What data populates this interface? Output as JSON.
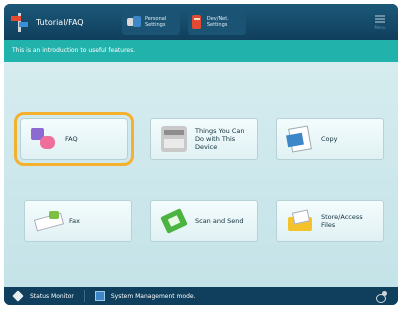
{
  "header": {
    "title": "Tutorial/FAQ",
    "personal_settings": "Personal Settings",
    "device_settings": "Dev/Net. Settings",
    "menu_label": "Menu"
  },
  "intro_text": "This is an introduction to useful features.",
  "tiles": [
    {
      "label": "FAQ",
      "icon": "faq-icon"
    },
    {
      "label": "Things You Can Do with This Device",
      "icon": "device-icon"
    },
    {
      "label": "Copy",
      "icon": "copy-icon"
    },
    {
      "label": "Fax",
      "icon": "fax-icon"
    },
    {
      "label": "Scan and Send",
      "icon": "scan-icon"
    },
    {
      "label": "Store/Access Files",
      "icon": "storage-icon"
    }
  ],
  "selected_tile": "FAQ",
  "footer": {
    "status_monitor": "Status Monitor",
    "system_mode": "System Management mode."
  },
  "colors": {
    "header": "#0f3f5c",
    "intro_bar": "#21b2ab",
    "content_bg": "#d6ecef",
    "selection_ring": "#f5b12d"
  }
}
